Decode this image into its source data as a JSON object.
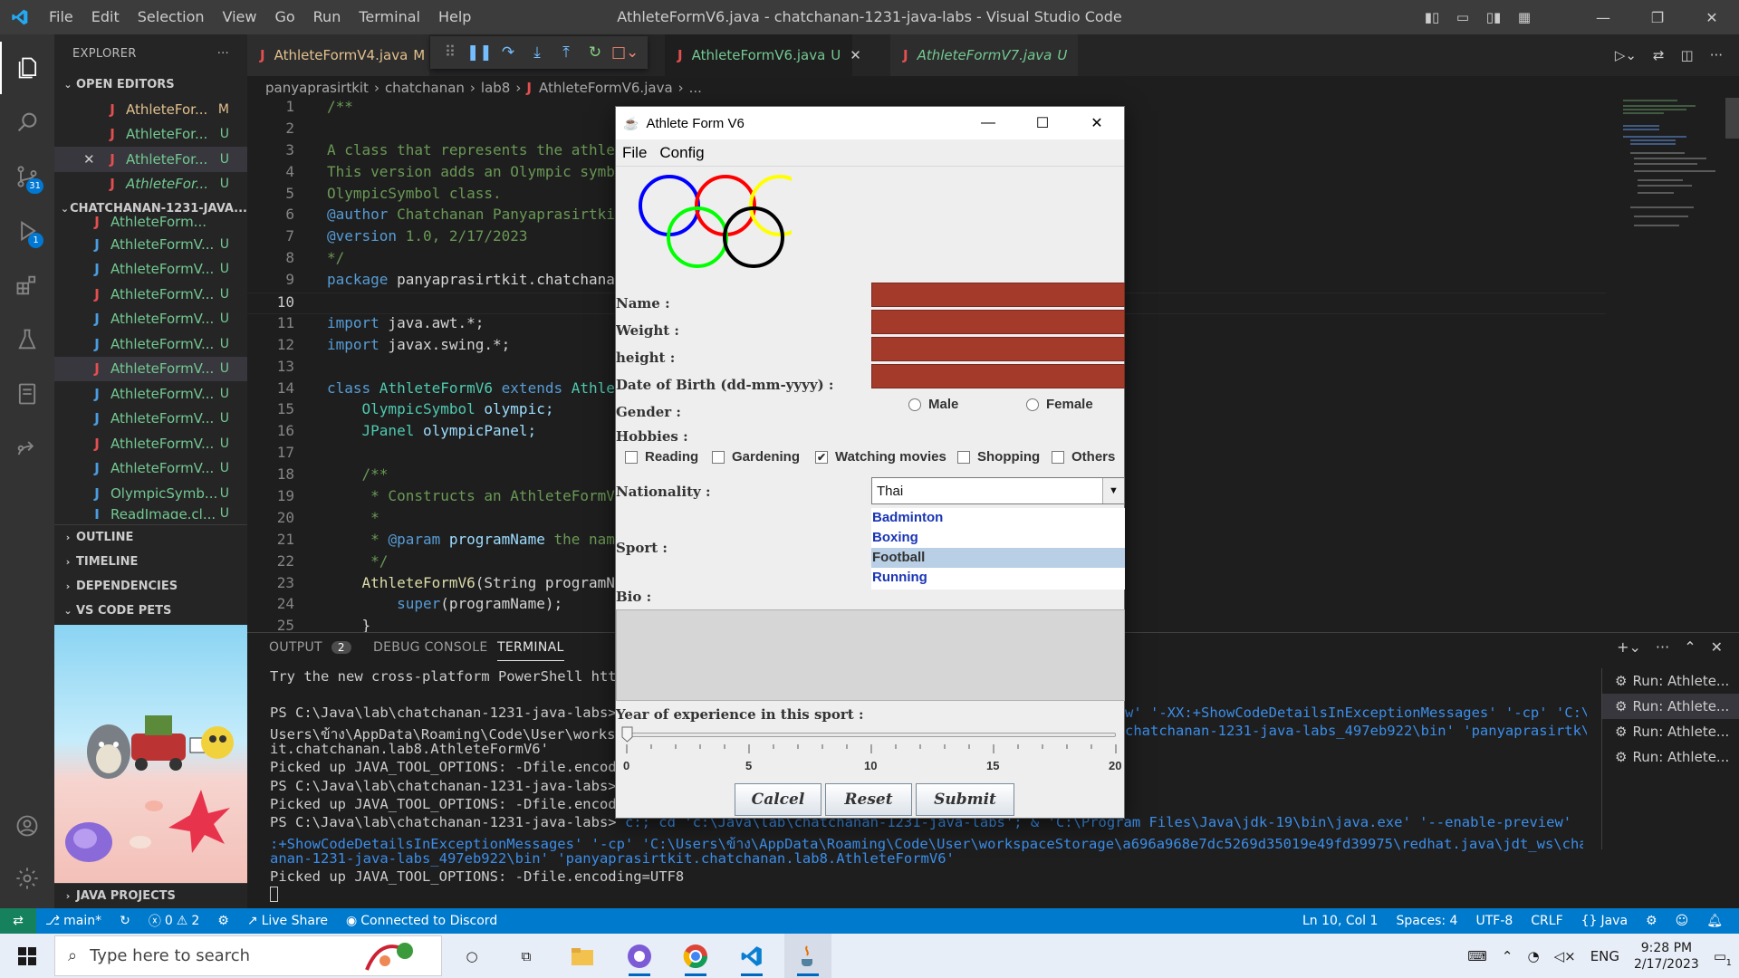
{
  "titlebar": {
    "menus": [
      "File",
      "Edit",
      "Selection",
      "View",
      "Go",
      "Run",
      "Terminal",
      "Help"
    ],
    "title": "AthleteFormV6.java - chatchanan-1231-java-labs - Visual Studio Code"
  },
  "activity": {
    "scm_badge": "31",
    "debug_badge": "1"
  },
  "sidebar": {
    "header": "EXPLORER",
    "open_editors_title": "OPEN EDITORS",
    "open_editors": [
      {
        "name": "AthleteFor...",
        "status": "M"
      },
      {
        "name": "AthleteFor...",
        "status": "U"
      },
      {
        "name": "AthleteFor...",
        "status": "U"
      },
      {
        "name": "AthleteFor...",
        "status": "U"
      }
    ],
    "project_title": "CHATCHANAN-1231-JAVA...",
    "files": [
      {
        "name": "AthleteForm...",
        "status": ""
      },
      {
        "name": "AthleteFormV...",
        "status": "U"
      },
      {
        "name": "AthleteFormV...",
        "status": "U"
      },
      {
        "name": "AthleteFormV...",
        "status": "U"
      },
      {
        "name": "AthleteFormV...",
        "status": "U"
      },
      {
        "name": "AthleteFormV...",
        "status": "U"
      },
      {
        "name": "AthleteFormV...",
        "status": "U"
      },
      {
        "name": "AthleteFormV...",
        "status": "U"
      },
      {
        "name": "AthleteFormV...",
        "status": "U"
      },
      {
        "name": "AthleteFormV...",
        "status": "U"
      },
      {
        "name": "AthleteFormV...",
        "status": "U"
      },
      {
        "name": "OlympicSymb...",
        "status": "U"
      },
      {
        "name": "ReadImage.cl...",
        "status": "U"
      }
    ],
    "outline": "OUTLINE",
    "timeline": "TIMELINE",
    "dependencies": "DEPENDENCIES",
    "pets": "VS CODE PETS",
    "java_projects": "JAVA PROJECTS"
  },
  "tabs": [
    {
      "name": "AthleteFormV4.java",
      "status": "M"
    },
    {
      "name": "AthleteFormV6.java",
      "status": "U"
    },
    {
      "name": "AthleteFormV7.java",
      "status": "U"
    }
  ],
  "breadcrumb": [
    "panyaprasirtkit",
    "chatchanan",
    "lab8",
    "AthleteFormV6.java",
    "..."
  ],
  "code": {
    "line_numbers": [
      "1",
      "2",
      "3",
      "4",
      "5",
      "6",
      "7",
      "8",
      "9",
      "10",
      "11",
      "12",
      "13",
      "14",
      "15",
      "16",
      "17",
      "18",
      "19",
      "20",
      "21",
      "22",
      "23",
      "24",
      "25"
    ],
    "l1": "/**",
    "l3": "A class that represents the athlet",
    "l4": "This version adds an Olympic symbo",
    "l5": "OlympicSymbol class.",
    "l6a": "@author",
    "l6b": " Chatchanan Panyaprasirtkit",
    "l7a": "@version",
    "l7b": " 1.0, 2/17/2023",
    "l8": "*/",
    "l9a": "package",
    "l9b": " panyaprasirtkit.chatchanan",
    "l11a": "import",
    "l11b": " java.awt.*;",
    "l12a": "import",
    "l12b": " javax.swing.*;",
    "l14a": "class",
    "l14b": " AthleteFormV6",
    "l14c": " extends",
    "l14d": " Athle",
    "l15a": "    OlympicSymbol",
    "l15b": " olympic;",
    "l16a": "    JPanel",
    "l16b": " olympicPanel;",
    "l18": "    /**",
    "l19": "     * Constructs an AthleteFormV",
    "l20": "     *",
    "l21a": "     * ",
    "l21b": "@param",
    "l21c": " programName",
    "l21d": " the name",
    "l22": "     */",
    "l23a": "    AthleteFormV6",
    "l23b": "(String programN",
    "l24a": "        super",
    "l24b": "(programName);",
    "l25": "    }"
  },
  "panel": {
    "tabs": [
      "OUTPUT",
      "DEBUG CONSOLE",
      "TERMINAL"
    ],
    "output_badge": "2",
    "terminal_lines": [
      "Try the new cross-platform PowerShell http",
      "",
      "PS C:\\Java\\lab\\chatchanan-1231-java-labs>",
      "Users\\ข้าง\\AppData\\Roaming\\Code\\User\\workspa",
      "it.chatchanan.lab8.AthleteFormV6'",
      "Picked up JAVA_TOOL_OPTIONS: -Dfile.encodi",
      "PS C:\\Java\\lab\\chatchanan-1231-java-labs>",
      "Picked up JAVA_TOOL_OPTIONS: -Dfile.encodi",
      "PS C:\\Java\\lab\\chatchanan-1231-java-labs>",
      ":+ShowCodeDetailsInExceptionMessages' '-cp' 'C:\\Users\\ข้าง\\AppData\\Roaming\\Code\\User\\workspaceStorage\\a696a968e7dc5269d35019e49fd39975\\redhat.java\\jdt_ws\\chatchX",
      "anan-1231-java-labs_497eb922\\bin' 'panyaprasirtkit.chatchanan.lab8.AthleteFormV6'",
      "Picked up JAVA_TOOL_OPTIONS: -Dfile.encoding=UTF8"
    ],
    "line3_right": "w' '-XX:+ShowCodeDetailsInExceptionMessages' '-cp' 'C:\\",
    "line4_right": "chatchanan-1231-java-labs_497eb922\\bin' 'panyaprasirtk\\",
    "line9_cmd": " c:; cd 'c:\\Java\\lab\\chatchanan-1231-java-labs'; & 'C:\\Program Files\\Java\\jdk-19\\bin\\java.exe' '--enable-preview' '-XX",
    "terminals": [
      "Run: Athlete...",
      "Run: Athlete...",
      "Run: Athlete...",
      "Run: Athlete..."
    ]
  },
  "status": {
    "branch": "main*",
    "problems": "0",
    "warnings": "2",
    "live_share": "Live Share",
    "discord": "Connected to Discord",
    "position": "Ln 10, Col 1",
    "spaces": "Spaces: 4",
    "encoding": "UTF-8",
    "eol": "CRLF",
    "language": "Java"
  },
  "taskbar": {
    "search_placeholder": "Type here to search",
    "lang": "ENG",
    "time": "9:28 PM",
    "date": "2/17/2023",
    "notif": "1"
  },
  "java_window": {
    "title": "Athlete Form V6",
    "menus": [
      "File",
      "Config"
    ],
    "labels": {
      "name": "Name :",
      "weight": "Weight :",
      "height": "height :",
      "dob": "Date of Birth (dd-mm-yyyy) :",
      "gender": "Gender :",
      "hobbies": "Hobbies :",
      "nationality": "Nationality :",
      "sport": "Sport :",
      "bio": "Bio :",
      "experience": "Year of experience in this sport :"
    },
    "gender_options": [
      "Male",
      "Female"
    ],
    "hobbies": [
      {
        "label": "Reading",
        "checked": false
      },
      {
        "label": "Gardening",
        "checked": false
      },
      {
        "label": "Watching movies",
        "checked": true
      },
      {
        "label": "Shopping",
        "checked": false
      },
      {
        "label": "Others",
        "checked": false
      }
    ],
    "nationality": "Thai",
    "sports": [
      "Badminton",
      "Boxing",
      "Football",
      "Running"
    ],
    "selected_sport": "Football",
    "slider": {
      "min": 0,
      "max": 20,
      "value": 0,
      "labels": [
        "0",
        "5",
        "10",
        "15",
        "20"
      ]
    },
    "buttons": [
      "Calcel",
      "Reset",
      "Submit"
    ],
    "ring_colors": [
      "#0000ff",
      "#ff0000",
      "#ffff00",
      "#00ff00",
      "#000000"
    ]
  }
}
